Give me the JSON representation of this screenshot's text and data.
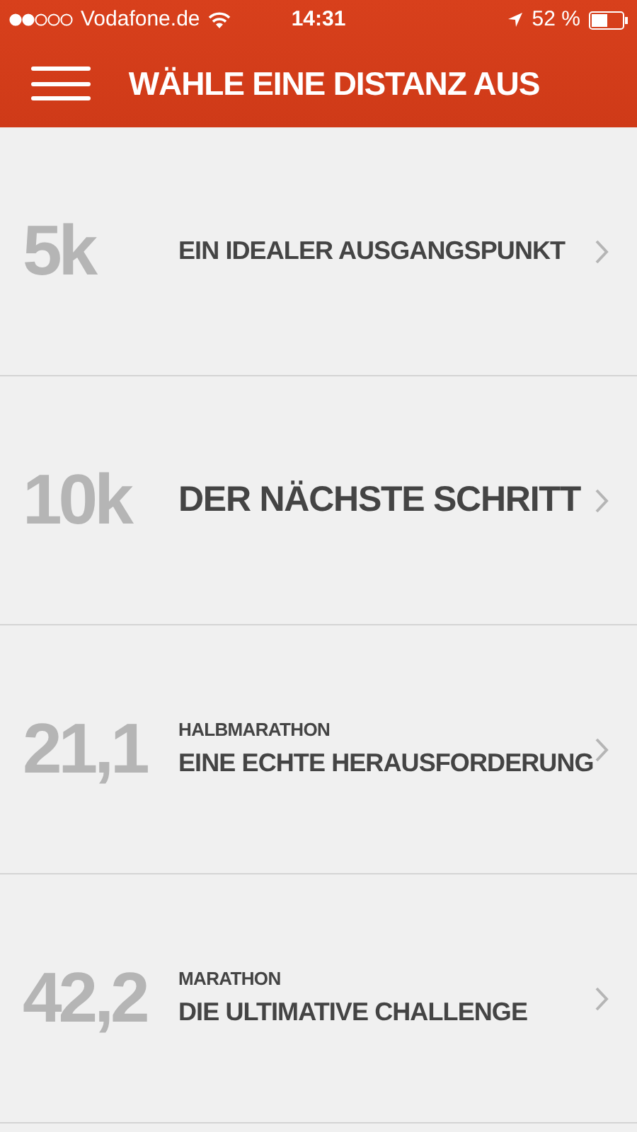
{
  "status_bar": {
    "carrier": "Vodafone.de",
    "time": "14:31",
    "battery": "52 %"
  },
  "header": {
    "title": "WÄHLE EINE DISTANZ AUS"
  },
  "distances": [
    {
      "kind": "plain",
      "distance": "5k",
      "title": "EIN IDEALER AUSGANGSPUNKT"
    },
    {
      "kind": "large",
      "distance": "10k",
      "title": "DER NÄCHSTE SCHRITT"
    },
    {
      "kind": "plain",
      "distance": "21,1",
      "label": "HALBMARATHON",
      "title": "EINE ECHTE HERAUSFORDERUNG"
    },
    {
      "kind": "plain",
      "distance": "42,2",
      "label": "MARATHON",
      "title": "DIE ULTIMATIVE CHALLENGE"
    }
  ]
}
